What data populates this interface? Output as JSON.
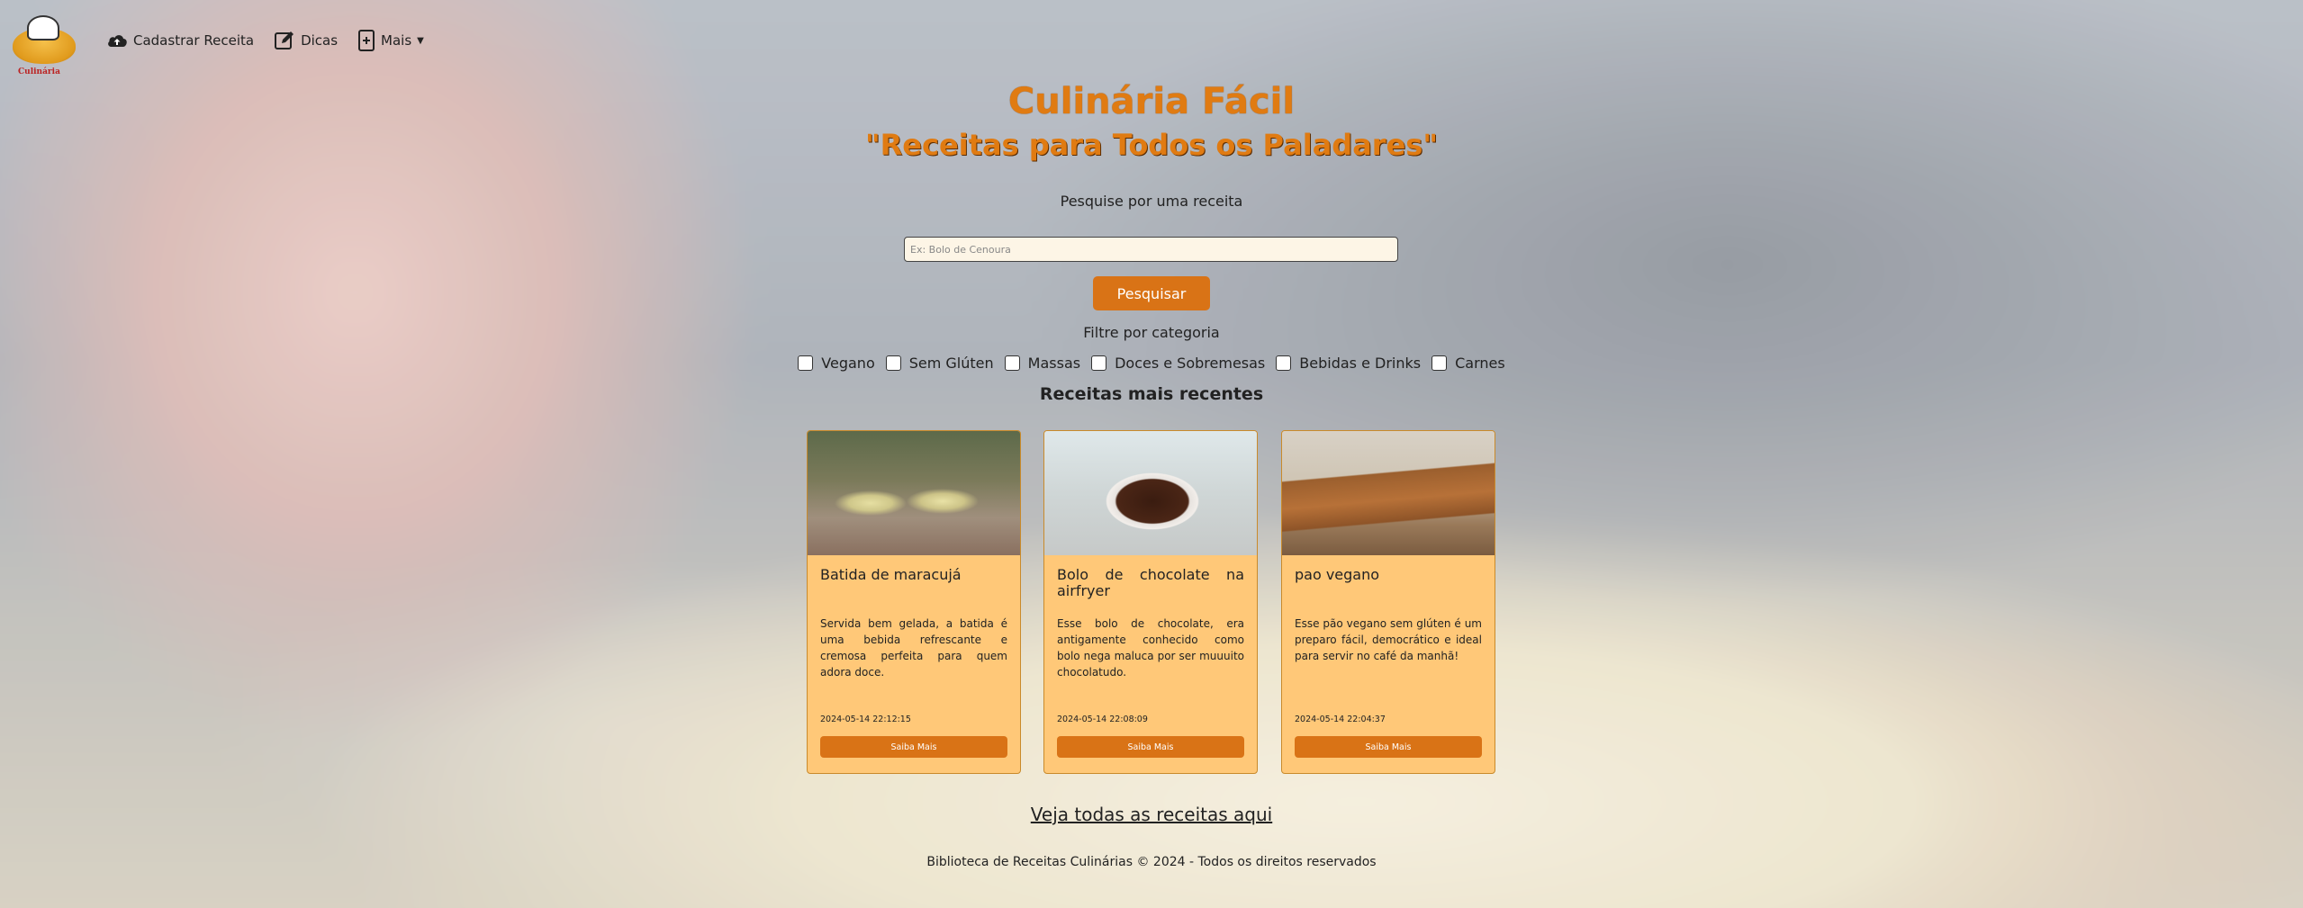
{
  "nav": {
    "logo_text": "Culinária",
    "items": [
      {
        "label": "Cadastrar Receita",
        "icon": "cloud-upload-icon"
      },
      {
        "label": "Dicas",
        "icon": "edit-icon"
      },
      {
        "label": "Mais",
        "icon": "plus-square-icon"
      }
    ]
  },
  "hero": {
    "title": "Culinária Fácil",
    "subtitle": "\"Receitas para Todos os Paladares\""
  },
  "search": {
    "label": "Pesquise por uma receita",
    "placeholder": "Ex: Bolo de Cenoura",
    "button": "Pesquisar"
  },
  "filters": {
    "label": "Filtre por categoria",
    "options": [
      "Vegano",
      "Sem Glúten",
      "Massas",
      "Doces e Sobremesas",
      "Bebidas e Drinks",
      "Carnes"
    ]
  },
  "recent": {
    "title": "Receitas mais recentes",
    "cards": [
      {
        "title": "Batida de maracujá",
        "text": "Servida bem gelada, a batida é uma bebida refrescante e cremosa perfeita para quem adora doce.",
        "date": "2024-05-14 22:12:15",
        "button": "Saiba Mais"
      },
      {
        "title": "Bolo de chocolate na airfryer",
        "text": "Esse bolo de chocolate, era antigamente conhecido como bolo nega maluca por ser muuuito chocolatudo.",
        "date": "2024-05-14 22:08:09",
        "button": "Saiba Mais"
      },
      {
        "title": "pao vegano",
        "text": "Esse pão vegano sem glúten é um preparo fácil, democrático e ideal para servir no café da manhã!",
        "date": "2024-05-14 22:04:37",
        "button": "Saiba Mais"
      }
    ],
    "see_all": "Veja todas as receitas aqui"
  },
  "footer": {
    "text": "Biblioteca de Receitas Culinárias © 2024 - Todos os direitos reservados"
  },
  "colors": {
    "accent": "#d97316",
    "title": "#e07b12",
    "card_bg": "#ffc878"
  }
}
